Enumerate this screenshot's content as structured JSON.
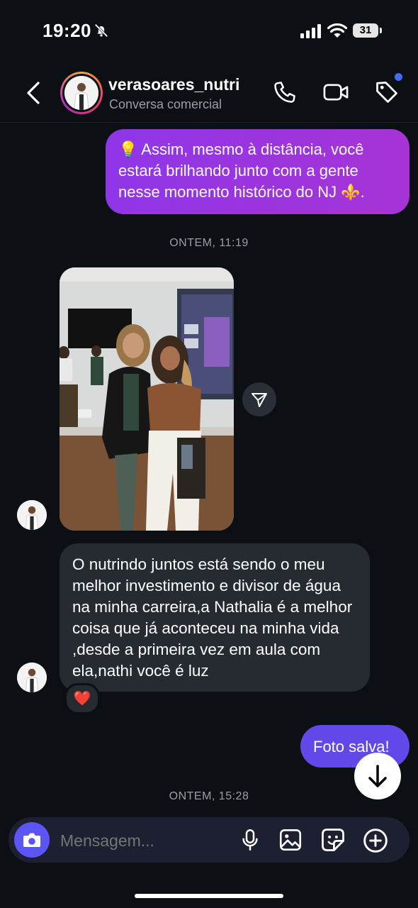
{
  "status_bar": {
    "time": "19:20",
    "battery": "31"
  },
  "header": {
    "username": "verasoares_nutri",
    "subtitle": "Conversa comercial"
  },
  "messages": {
    "sent_1": "💡 Assim, mesmo à distância, você estará brilhando junto com a gente nesse momento histórico do NJ ⚜️.",
    "timestamp_1": "ONTEM, 11:19",
    "received_text": "O nutrindo juntos está sendo o meu melhor investimento e divisor de água na minha carreira,a Nathalia é a melhor coisa que já aconteceu na minha vida ,desde a primeira vez em aula com ela,nathi você é luz",
    "reaction": "❤️",
    "sent_2": "Foto salva!",
    "timestamp_2": "ONTEM, 15:28"
  },
  "composer": {
    "placeholder": "Mensagem..."
  },
  "colors": {
    "background": "#0c0f14",
    "outgoing_gradient": [
      "#8f36e8",
      "#a733d6"
    ],
    "outgoing_solid": "#6248e8",
    "incoming": "#262a31",
    "camera_button": "#5b55f5"
  }
}
